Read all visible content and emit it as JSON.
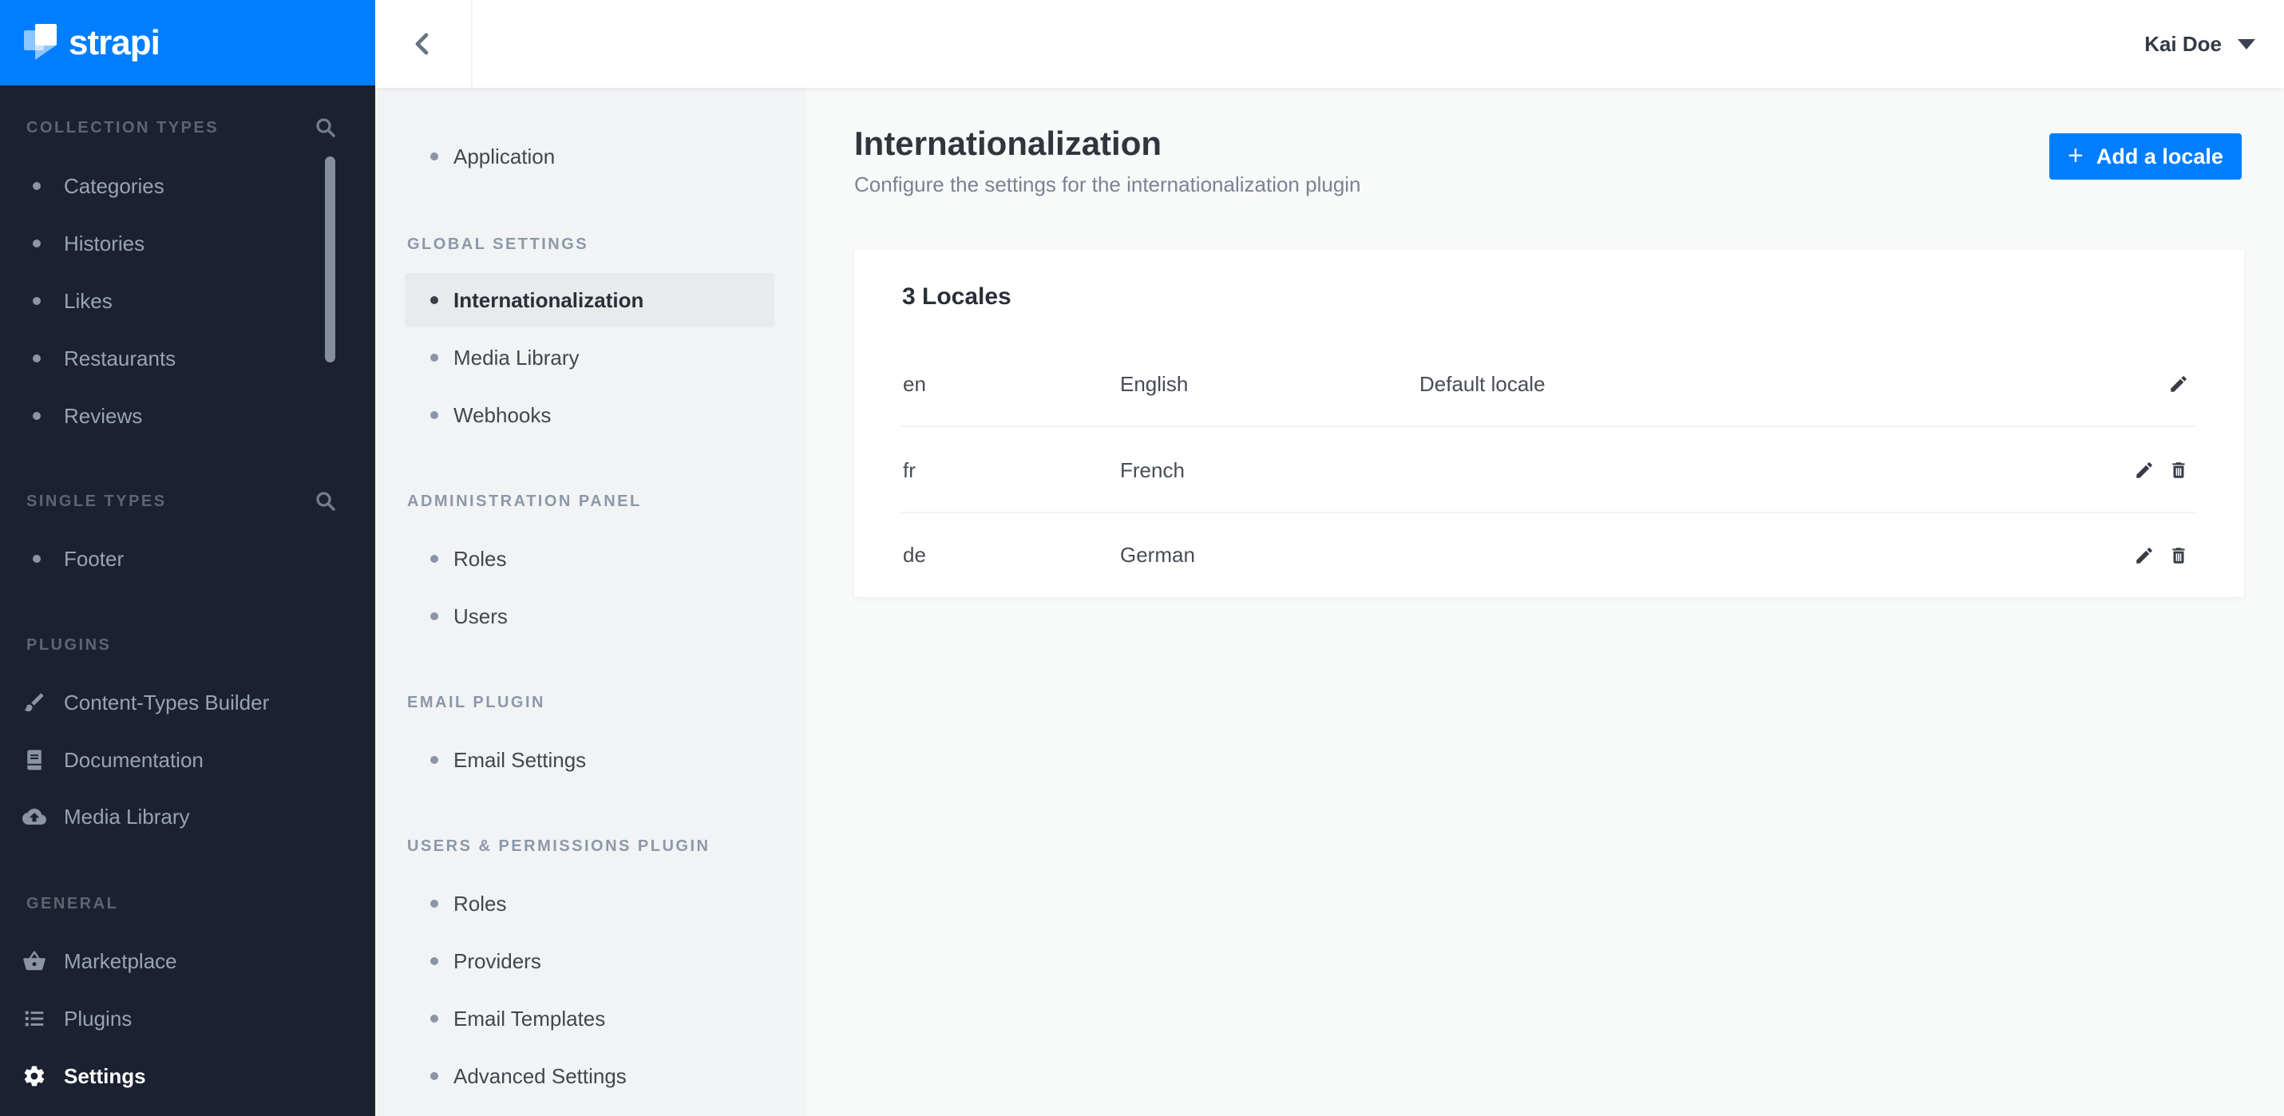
{
  "colors": {
    "brand_blue": "#007eff",
    "sidebar_dark": "#1b2130",
    "settings_sidebar_bg": "#f2f3f4",
    "active_item_bg": "#e9eaec"
  },
  "brand": {
    "logo_text": "strapi"
  },
  "topbar": {
    "user_name": "Kai Doe"
  },
  "main_sidebar": {
    "sections": [
      {
        "label": "COLLECTION TYPES",
        "search_icon": "search-icon",
        "items": [
          {
            "label": "Categories"
          },
          {
            "label": "Histories"
          },
          {
            "label": "Likes"
          },
          {
            "label": "Restaurants"
          },
          {
            "label": "Reviews"
          }
        ]
      },
      {
        "label": "SINGLE TYPES",
        "search_icon": "search-icon",
        "items": [
          {
            "label": "Footer"
          }
        ]
      },
      {
        "label": "PLUGINS",
        "items": [
          {
            "label": "Content-Types Builder",
            "icon": "paintbrush-icon"
          },
          {
            "label": "Documentation",
            "icon": "book-icon"
          },
          {
            "label": "Media Library",
            "icon": "cloud-upload-icon"
          }
        ]
      },
      {
        "label": "GENERAL",
        "items": [
          {
            "label": "Marketplace",
            "icon": "basket-icon"
          },
          {
            "label": "Plugins",
            "icon": "list-icon"
          },
          {
            "label": "Settings",
            "icon": "gear-icon",
            "active": true
          }
        ]
      }
    ]
  },
  "settings_sidebar": {
    "standalone_item": {
      "label": "Application"
    },
    "sections": [
      {
        "label": "GLOBAL SETTINGS",
        "items": [
          {
            "label": "Internationalization",
            "active": true
          },
          {
            "label": "Media Library"
          },
          {
            "label": "Webhooks"
          }
        ]
      },
      {
        "label": "ADMINISTRATION PANEL",
        "items": [
          {
            "label": "Roles"
          },
          {
            "label": "Users"
          }
        ]
      },
      {
        "label": "EMAIL PLUGIN",
        "items": [
          {
            "label": "Email Settings"
          }
        ]
      },
      {
        "label": "USERS & PERMISSIONS PLUGIN",
        "items": [
          {
            "label": "Roles"
          },
          {
            "label": "Providers"
          },
          {
            "label": "Email Templates"
          },
          {
            "label": "Advanced Settings"
          }
        ]
      }
    ]
  },
  "page": {
    "title": "Internationalization",
    "subtitle": "Configure the settings for the internationalization plugin",
    "add_locale_button": "Add a locale",
    "plus_glyph": "+"
  },
  "locales": {
    "card_title": "3 Locales",
    "rows": [
      {
        "code": "en",
        "name": "English",
        "note": "Default locale",
        "can_delete": false
      },
      {
        "code": "fr",
        "name": "French",
        "note": "",
        "can_delete": true
      },
      {
        "code": "de",
        "name": "German",
        "note": "",
        "can_delete": true
      }
    ]
  }
}
